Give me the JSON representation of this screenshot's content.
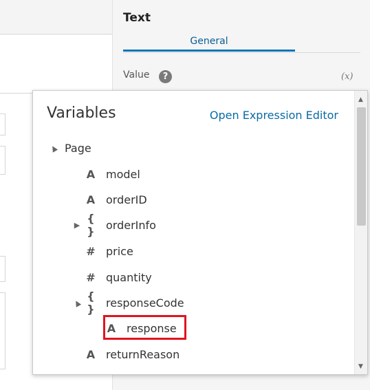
{
  "panel": {
    "title": "Text",
    "tab_general": "General",
    "value_label": "Value",
    "help_icon": "?",
    "expression_icon": "(x)"
  },
  "popup": {
    "title": "Variables",
    "open_editor_link": "Open Expression Editor",
    "tree": [
      {
        "label": "Page",
        "icon": "",
        "caret": "▲"
      },
      {
        "label": "model",
        "icon": "A",
        "caret": ""
      },
      {
        "label": "orderID",
        "icon": "A",
        "caret": ""
      },
      {
        "label": "orderInfo",
        "icon": "{ }",
        "caret": "▶"
      },
      {
        "label": "price",
        "icon": "#",
        "caret": ""
      },
      {
        "label": "quantity",
        "icon": "#",
        "caret": ""
      },
      {
        "label": "responseCode",
        "icon": "{ }",
        "caret": "▲"
      },
      {
        "label": "response",
        "icon": "A",
        "caret": ""
      },
      {
        "label": "returnReason",
        "icon": "A",
        "caret": ""
      }
    ]
  },
  "scrollbar": {
    "up_arrow": "▲",
    "down_arrow": "▼"
  },
  "colors": {
    "accent": "#0b74b9",
    "link": "#0a6aa3",
    "highlight": "#e0141e"
  }
}
